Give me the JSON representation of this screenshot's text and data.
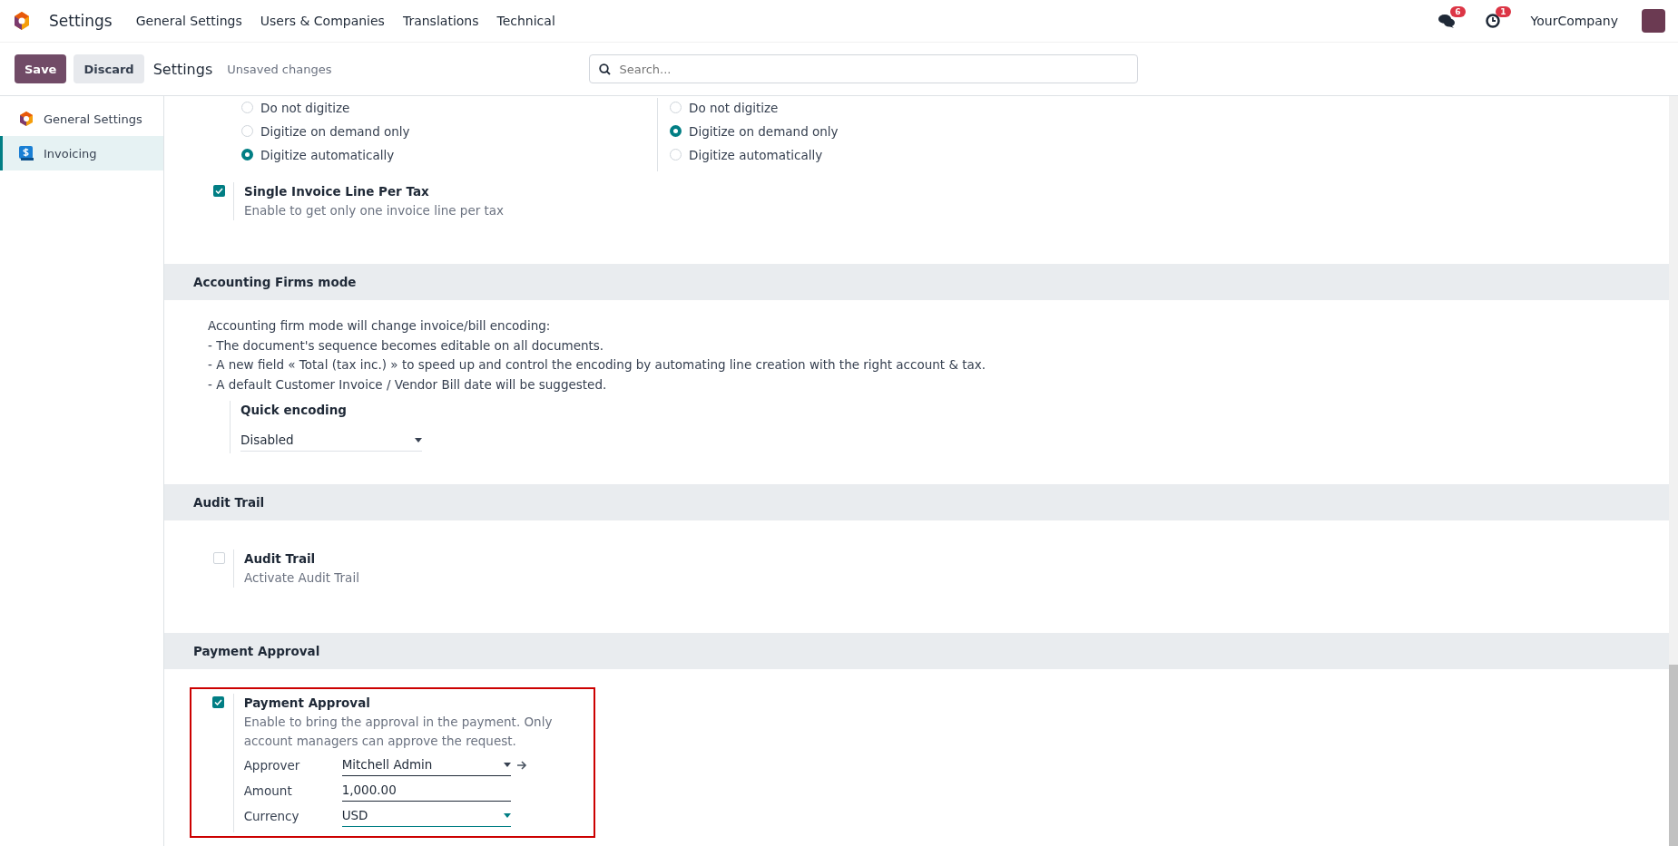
{
  "navbar": {
    "app": "Settings",
    "menu": [
      "General Settings",
      "Users & Companies",
      "Translations",
      "Technical"
    ],
    "messages_badge": "6",
    "activities_badge": "1",
    "company": "YourCompany"
  },
  "control_bar": {
    "save": "Save",
    "discard": "Discard",
    "title": "Settings",
    "status": "Unsaved changes",
    "search_placeholder": "Search..."
  },
  "sidebar": {
    "items": [
      {
        "label": "General Settings",
        "selected": false
      },
      {
        "label": "Invoicing",
        "selected": true
      }
    ]
  },
  "digitize": {
    "columns": [
      {
        "options": [
          {
            "label": "Do not digitize",
            "selected": false
          },
          {
            "label": "Digitize on demand only",
            "selected": false
          },
          {
            "label": "Digitize automatically",
            "selected": true
          }
        ]
      },
      {
        "options": [
          {
            "label": "Do not digitize",
            "selected": false
          },
          {
            "label": "Digitize on demand only",
            "selected": true
          },
          {
            "label": "Digitize automatically",
            "selected": false
          }
        ]
      }
    ]
  },
  "single_invoice_line": {
    "title": "Single Invoice Line Per Tax",
    "description": "Enable to get only one invoice line per tax",
    "checked": true
  },
  "accounting_firms": {
    "header": "Accounting Firms mode",
    "description": [
      "Accounting firm mode will change invoice/bill encoding:",
      "- The document's sequence becomes editable on all documents.",
      "- A new field « Total (tax inc.) » to speed up and control the encoding by automating line creation with the right account & tax.",
      "- A default Customer Invoice / Vendor Bill date will be suggested."
    ],
    "quick_encoding": {
      "label": "Quick encoding",
      "value": "Disabled"
    }
  },
  "audit_trail": {
    "header": "Audit Trail",
    "setting": {
      "title": "Audit Trail",
      "description": "Activate Audit Trail",
      "checked": false
    }
  },
  "payment_approval": {
    "header": "Payment Approval",
    "highlighted": true,
    "setting": {
      "title": "Payment Approval",
      "description": "Enable to bring the approval in the payment. Only account managers can approve the request.",
      "checked": true,
      "fields": [
        {
          "kind": "many2one",
          "label": "Approver",
          "value": "Mitchell Admin"
        },
        {
          "kind": "input",
          "label": "Amount",
          "value": "1,000.00"
        },
        {
          "kind": "select",
          "label": "Currency",
          "value": "USD"
        }
      ]
    }
  }
}
